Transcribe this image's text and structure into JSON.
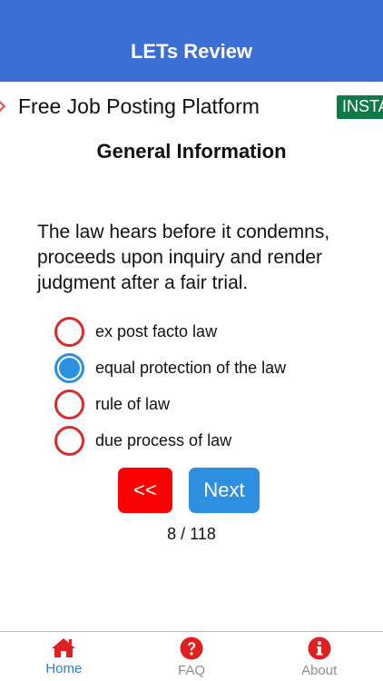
{
  "header": {
    "title": "LETs Review"
  },
  "ad": {
    "text": "Free Job Posting Platform",
    "install_label": "INSTALL"
  },
  "quiz": {
    "section_title": "General Information",
    "question": "The law hears before it condemns, proceeds upon inquiry and render judgment after a fair trial.",
    "options": [
      {
        "label": "ex post facto law",
        "selected": false
      },
      {
        "label": "equal protection of the law",
        "selected": true
      },
      {
        "label": "rule of law",
        "selected": false
      },
      {
        "label": "due process of law",
        "selected": false
      }
    ],
    "prev_label": "<<",
    "next_label": "Next",
    "progress": "8 / 118"
  },
  "tabs": [
    {
      "label": "Home",
      "icon": "home-icon",
      "active": true
    },
    {
      "label": "FAQ",
      "icon": "question-circle-icon",
      "active": false
    },
    {
      "label": "About",
      "icon": "info-circle-icon",
      "active": false
    }
  ],
  "colors": {
    "header": "#3b6fd4",
    "radio_unselected": "#d32f2f",
    "radio_selected": "#2d8fe0",
    "prev_button": "#ff0000",
    "next_button": "#2d8fe0",
    "tab_icon": "#e02020",
    "install_button": "#0f7a46"
  }
}
